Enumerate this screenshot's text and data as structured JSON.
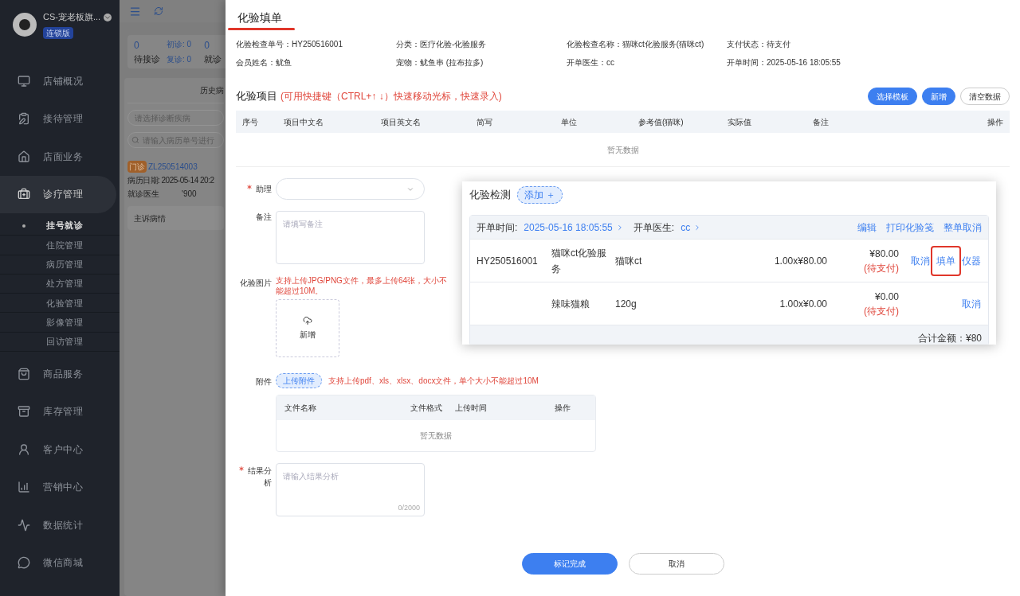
{
  "sidebar": {
    "store_name": "CS-宠老板旗...",
    "badge": "连锁版",
    "items": [
      {
        "label": "店铺概况",
        "selected": false
      },
      {
        "label": "接待管理",
        "selected": false
      },
      {
        "label": "店面业务",
        "selected": false
      },
      {
        "label": "诊疗管理",
        "selected": true,
        "children": [
          {
            "label": "挂号就诊",
            "selected": true
          },
          {
            "label": "住院管理",
            "selected": false
          },
          {
            "label": "病历管理",
            "selected": false
          },
          {
            "label": "处方管理",
            "selected": false
          },
          {
            "label": "化验管理",
            "selected": false
          },
          {
            "label": "影像管理",
            "selected": false
          },
          {
            "label": "回访管理",
            "selected": false
          }
        ]
      },
      {
        "label": "商品服务",
        "selected": false
      },
      {
        "label": "库存管理",
        "selected": false
      },
      {
        "label": "客户中心",
        "selected": false
      },
      {
        "label": "营销中心",
        "selected": false
      },
      {
        "label": "数据统计",
        "selected": false
      },
      {
        "label": "微信商城",
        "selected": false
      }
    ]
  },
  "background": {
    "stats": [
      {
        "value": "0",
        "label": "待接诊"
      },
      {
        "value": "0",
        "label": "就诊"
      }
    ],
    "sub_stats": [
      "初诊: 0",
      "复诊: 0"
    ],
    "history_title": "历史病",
    "diagnosis_placeholder": "请选择诊断疾病",
    "search_placeholder": "请输入病历单号进行",
    "record": {
      "tag": "门诊",
      "number": "ZL250514003",
      "date": "病历日期: 2025-05-14 20:2",
      "doctor_label": "就诊医生",
      "doctor_tail": "'900"
    },
    "section": "主诉病情"
  },
  "drawer": {
    "title": "化验填单",
    "info": [
      {
        "label": "化验检查单号：",
        "value": "HY250516001"
      },
      {
        "label": "分类：",
        "value": "医疗化验-化验服务"
      },
      {
        "label": "化验检查名称：",
        "value": "猫咪ct化验服务(猫咪ct)"
      },
      {
        "label": "支付状态：",
        "value": "待支付"
      },
      {
        "label": "会员姓名：",
        "value": "鱿鱼"
      },
      {
        "label": "宠物：",
        "value": "鱿鱼串 (拉布拉多)"
      },
      {
        "label": "开单医生：",
        "value": "cc"
      },
      {
        "label": "开单时间：",
        "value": "2025-05-16 18:05:55"
      }
    ],
    "items_title": "化验项目",
    "items_hint": "(可用快捷键（CTRL+↑ ↓）快速移动光标，快速录入)",
    "buttons": [
      {
        "label": "选择模板",
        "kind": "primary"
      },
      {
        "label": "新增",
        "kind": "primary"
      },
      {
        "label": "清空数据",
        "kind": "plain"
      }
    ],
    "table": {
      "columns": [
        "序号",
        "项目中文名",
        "项目英文名",
        "简写",
        "单位",
        "参考值(猫咪)",
        "实际值",
        "备注",
        "操作"
      ],
      "empty": "暂无数据"
    },
    "form": {
      "assistant_label": "助理",
      "assistant_required": true,
      "note_label": "备注",
      "note_placeholder": "请填写备注",
      "image_label": "化验图片",
      "image_hint": "支持上传JPG/PNG文件，最多上传64张，大小不能超过10M。",
      "image_upload": "新增",
      "attach_label": "附件",
      "attach_button": "上传附件",
      "attach_hint": "支持上传pdf、xls、xlsx、docx文件，单个大小不能超过10M",
      "files": {
        "columns": [
          "文件名称",
          "文件格式",
          "上传时间",
          "操作"
        ],
        "empty": "暂无数据"
      },
      "result_label": "结果分析",
      "result_required": true,
      "result_placeholder": "请输入结果分析",
      "result_counter": "0/2000"
    },
    "footer": [
      {
        "label": "标记完成",
        "kind": "primary"
      },
      {
        "label": "取消",
        "kind": "plain"
      }
    ]
  },
  "popup": {
    "title": "化验检测",
    "add_button": "添加 ＋",
    "time_label": "开单时间:",
    "time_value": "2025-05-16 18:05:55",
    "doctor_label": "开单医生:",
    "doctor_value": "cc",
    "links": [
      "编辑",
      "打印化验笺",
      "整单取消"
    ],
    "rows": [
      {
        "number": "HY250516001",
        "name": "猫咪ct化验服务",
        "spec": "猫咪ct",
        "qty": "1.00x¥80.00",
        "amount": "¥80.00",
        "status": "(待支付)",
        "actions": [
          {
            "label": "取消",
            "highlighted": false
          },
          {
            "label": "填单",
            "highlighted": true
          },
          {
            "label": "仪器",
            "highlighted": false
          }
        ]
      },
      {
        "number": "",
        "name": "辣味猫粮",
        "spec": "120g",
        "qty": "1.00x¥0.00",
        "amount": "¥0.00",
        "status": "(待支付)",
        "actions": [
          {
            "label": "取消",
            "highlighted": false
          }
        ]
      }
    ],
    "total": "合计金额：¥80"
  }
}
